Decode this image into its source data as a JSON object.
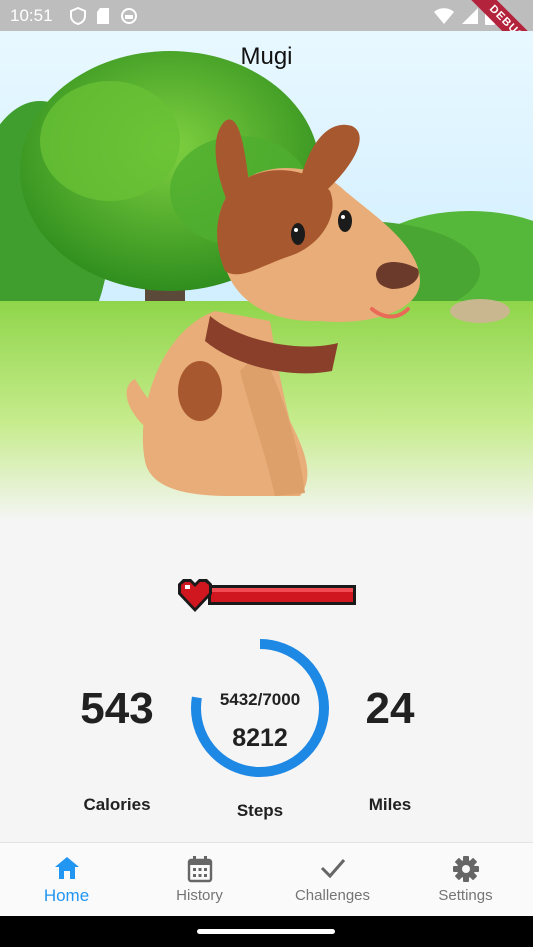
{
  "status_bar": {
    "time": "10:51",
    "debug_label": "DEBUG"
  },
  "pet": {
    "name": "Mugi"
  },
  "stats": {
    "calories_value": "543",
    "calories_label": "Calories",
    "steps_progress_text": "5432/7000",
    "steps_value": "8212",
    "steps_label": "Steps",
    "steps_progress_fraction": 0.776,
    "miles_value": "24",
    "miles_label": "Miles"
  },
  "health": {
    "level": 1.0,
    "bar_color": "#d0161f"
  },
  "bottom_nav": {
    "items": [
      {
        "label": "Home",
        "icon": "home-icon",
        "active": true
      },
      {
        "label": "History",
        "icon": "calendar-icon",
        "active": false
      },
      {
        "label": "Challenges",
        "icon": "check-icon",
        "active": false
      },
      {
        "label": "Settings",
        "icon": "gear-icon",
        "active": false
      }
    ]
  },
  "colors": {
    "accent": "#2196f3",
    "ring": "#1e88e5",
    "debug_banner": "#b4233c"
  }
}
